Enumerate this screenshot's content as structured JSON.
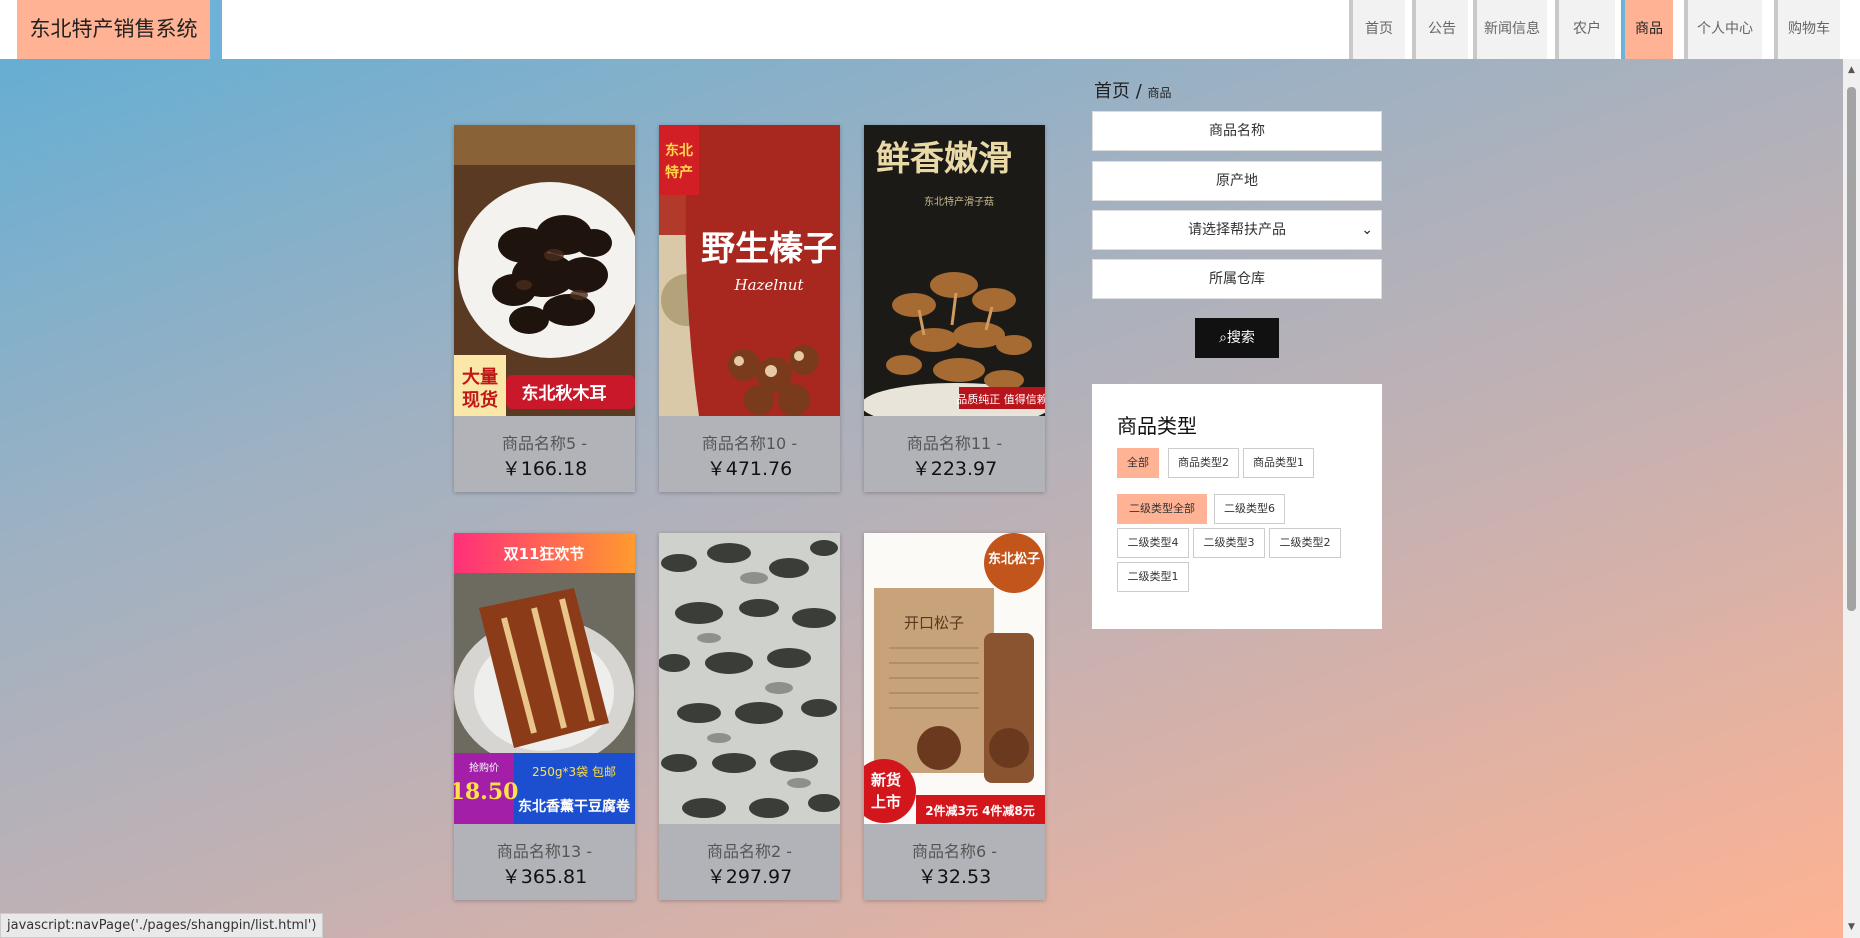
{
  "header": {
    "brand": "东北特产销售系统",
    "nav": [
      "首页",
      "公告",
      "新闻信息",
      "农户",
      "商品",
      "个人中心",
      "购物车"
    ],
    "active": "商品"
  },
  "products": [
    {
      "name": "商品名称5 -",
      "price": "￥166.18",
      "image_text": [
        "大量",
        "现货",
        "东北秋木耳"
      ]
    },
    {
      "name": "商品名称10 -",
      "price": "￥471.76",
      "image_text": [
        "东北",
        "特产",
        "野生榛子",
        "Hazelnut"
      ]
    },
    {
      "name": "商品名称11 -",
      "price": "￥223.97",
      "image_text": [
        "鲜香嫩滑",
        "东北特产滑子菇",
        "品质纯正 值得信赖"
      ]
    },
    {
      "name": "商品名称13 -",
      "price": "￥365.81",
      "image_text": [
        "双11狂欢节",
        "抢购价",
        "18.50",
        "250g*3袋 包邮",
        "东北香薰干豆腐卷"
      ]
    },
    {
      "name": "商品名称2 -",
      "price": "￥297.97",
      "image_text": []
    },
    {
      "name": "商品名称6 -",
      "price": "￥32.53",
      "image_text": [
        "东北松子",
        "开口松子",
        "新货",
        "上市",
        "2件减3元 4件减8元"
      ]
    }
  ],
  "sidebar": {
    "breadcrumb_home": "首页",
    "breadcrumb_sep": " / ",
    "breadcrumb_current": "商品",
    "name_placeholder": "商品名称",
    "origin_placeholder": "原产地",
    "select_label": "请选择帮扶产品",
    "warehouse_placeholder": "所属仓库",
    "search_label": "搜索",
    "types_title": "商品类型",
    "level1": [
      "全部",
      "商品类型2",
      "商品类型1"
    ],
    "level2": [
      "二级类型全部",
      "二级类型6",
      "二级类型4",
      "二级类型3",
      "二级类型2",
      "二级类型1"
    ]
  },
  "status_bar": "javascript:navPage('./pages/shangpin/list.html')",
  "colors": {
    "accent": "#ffb294",
    "nav_edge": "#6fb2d8",
    "search_btn": "#111111"
  }
}
